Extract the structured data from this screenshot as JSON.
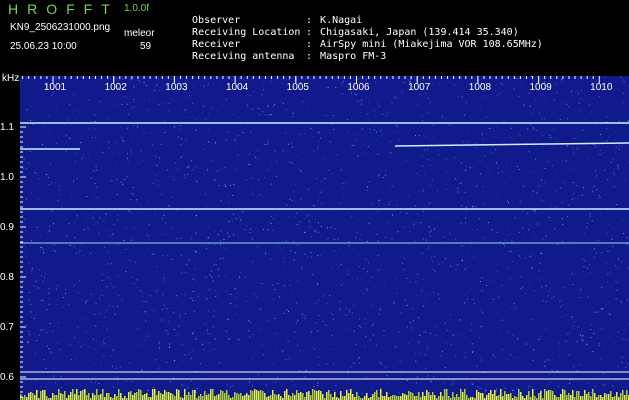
{
  "header": {
    "app_title": "HROFFT",
    "version": "1.0.0f",
    "filename": "KN9_2506231000.png",
    "mode": "meleor",
    "datetime": "25.06.23 10:00",
    "count": "59"
  },
  "info": [
    {
      "label": "Observer",
      "value": "K.Nagai"
    },
    {
      "label": "Receiving Location",
      "value": "Chigasaki, Japan (139.414 35.340)"
    },
    {
      "label": "Receiver",
      "value": "AirSpy mini (Miakejima VOR 108.65MHz)"
    },
    {
      "label": "Receiving antenna",
      "value": "Maspro FM-3"
    }
  ],
  "spectrogram": {
    "y_unit": "kHz",
    "y_ticks": [
      "1.1",
      "1.0",
      "0.9",
      "0.8",
      "0.7",
      "0.6"
    ],
    "y_labels": [
      "1.1",
      "1.0",
      "0.9",
      "0.8",
      "0.7",
      "0.6"
    ],
    "x_labels": [
      "1001",
      "1002",
      "1003",
      "1004",
      "1005",
      "1006",
      "1007",
      "1008",
      "1009",
      "1010"
    ],
    "colors": {
      "background": "#101a8a",
      "trace": "#c8f0ff",
      "axis": "#ffffff",
      "header_green": "#7bd34a"
    }
  }
}
